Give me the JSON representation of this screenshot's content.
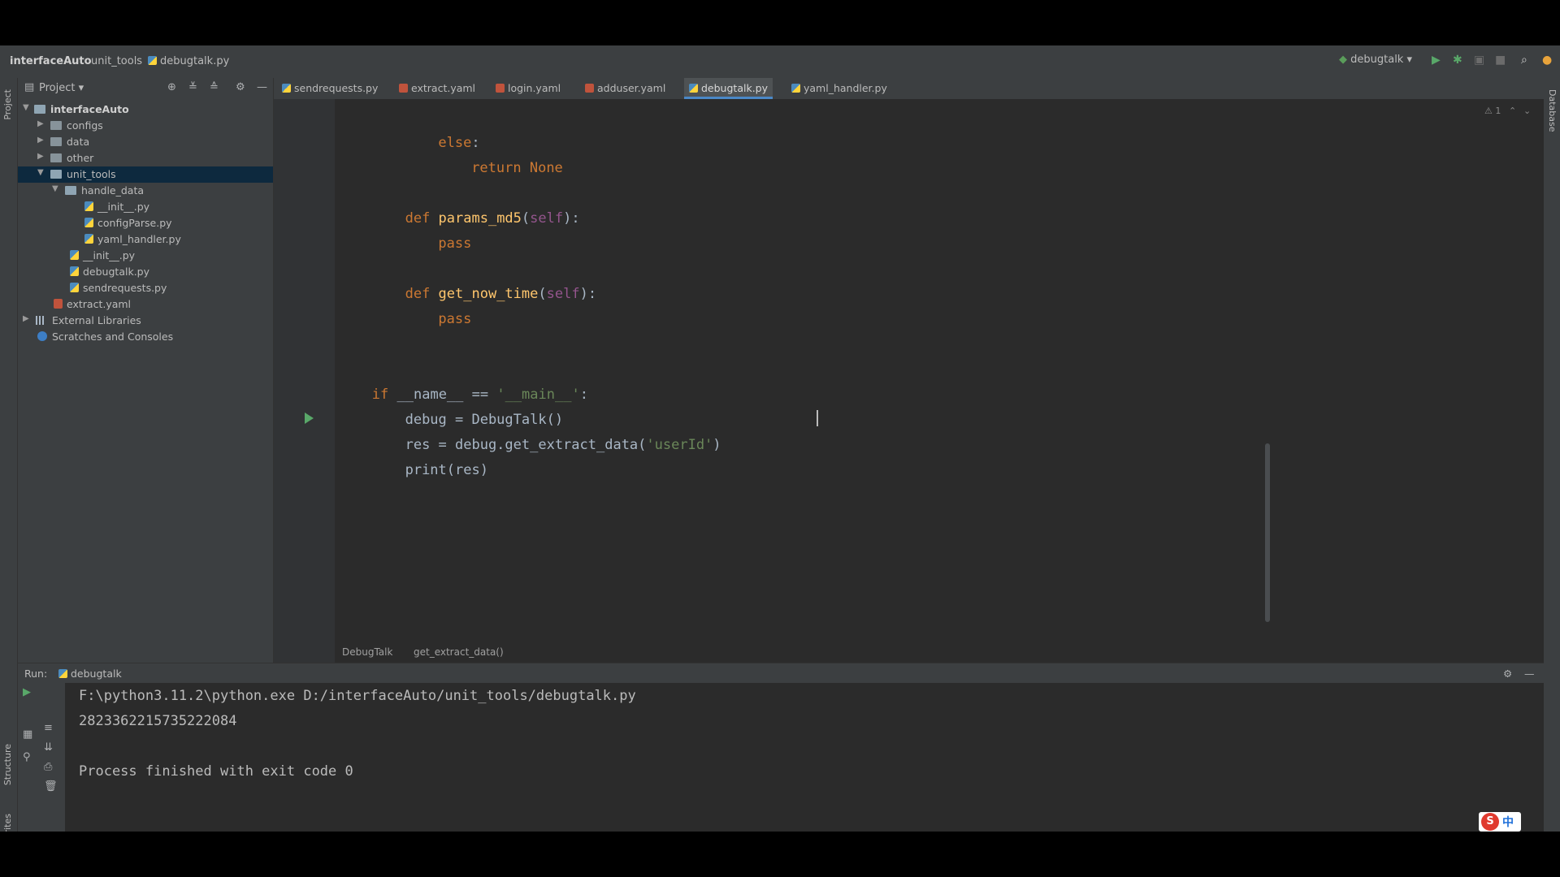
{
  "navbar": {
    "project": "interfaceAuto",
    "folder": "unit_tools",
    "file": "debugtalk.py",
    "run_config": "debugtalk"
  },
  "project_panel": {
    "title": "Project",
    "tree": [
      {
        "name": "interfaceAuto",
        "type": "root",
        "expanded": true
      },
      {
        "name": "configs",
        "type": "folder"
      },
      {
        "name": "data",
        "type": "folder"
      },
      {
        "name": "other",
        "type": "folder"
      },
      {
        "name": "unit_tools",
        "type": "folder",
        "expanded": true,
        "selected": true
      },
      {
        "name": "handle_data",
        "type": "folder",
        "expanded": true
      },
      {
        "name": "__init__.py",
        "type": "py"
      },
      {
        "name": "configParse.py",
        "type": "py"
      },
      {
        "name": "yaml_handler.py",
        "type": "py"
      },
      {
        "name": "__init__.py",
        "type": "py"
      },
      {
        "name": "debugtalk.py",
        "type": "py"
      },
      {
        "name": "sendrequests.py",
        "type": "py"
      },
      {
        "name": "extract.yaml",
        "type": "yaml"
      },
      {
        "name": "External Libraries",
        "type": "lib"
      },
      {
        "name": "Scratches and Consoles",
        "type": "scratch"
      }
    ]
  },
  "tabs": [
    {
      "label": "sendrequests.py",
      "type": "py"
    },
    {
      "label": "extract.yaml",
      "type": "yaml"
    },
    {
      "label": "login.yaml",
      "type": "yaml"
    },
    {
      "label": "adduser.yaml",
      "type": "yaml"
    },
    {
      "label": "debugtalk.py",
      "type": "py",
      "active": true
    },
    {
      "label": "yaml_handler.py",
      "type": "py"
    }
  ],
  "editor": {
    "lines": [
      {
        "indent": 12,
        "tokens": [
          {
            "t": "else",
            "c": "kw"
          },
          {
            "t": ":",
            "c": ""
          }
        ]
      },
      {
        "indent": 16,
        "tokens": [
          {
            "t": "return ",
            "c": "kw"
          },
          {
            "t": "None",
            "c": "kw"
          }
        ]
      },
      {
        "indent": 0,
        "tokens": []
      },
      {
        "indent": 8,
        "tokens": [
          {
            "t": "def ",
            "c": "kw"
          },
          {
            "t": "params_md5",
            "c": "fn"
          },
          {
            "t": "(",
            "c": ""
          },
          {
            "t": "self",
            "c": "self"
          },
          {
            "t": "):",
            "c": ""
          }
        ]
      },
      {
        "indent": 12,
        "tokens": [
          {
            "t": "pass",
            "c": "kw"
          }
        ]
      },
      {
        "indent": 0,
        "tokens": []
      },
      {
        "indent": 8,
        "tokens": [
          {
            "t": "def ",
            "c": "kw"
          },
          {
            "t": "get_now_time",
            "c": "fn"
          },
          {
            "t": "(",
            "c": ""
          },
          {
            "t": "self",
            "c": "self"
          },
          {
            "t": "):",
            "c": ""
          }
        ]
      },
      {
        "indent": 12,
        "tokens": [
          {
            "t": "pass",
            "c": "kw"
          }
        ]
      },
      {
        "indent": 0,
        "tokens": []
      },
      {
        "indent": 0,
        "tokens": []
      },
      {
        "indent": 4,
        "tokens": [
          {
            "t": "if ",
            "c": "kw"
          },
          {
            "t": "__name__ == ",
            "c": ""
          },
          {
            "t": "'__main__'",
            "c": "str"
          },
          {
            "t": ":",
            "c": ""
          }
        ]
      },
      {
        "indent": 8,
        "tokens": [
          {
            "t": "debug = DebugTalk()",
            "c": ""
          }
        ]
      },
      {
        "indent": 8,
        "tokens": [
          {
            "t": "res = debug.get_extract_data(",
            "c": ""
          },
          {
            "t": "'userId'",
            "c": "str"
          },
          {
            "t": ")",
            "c": ""
          }
        ]
      },
      {
        "indent": 8,
        "tokens": [
          {
            "t": "print(res)",
            "c": ""
          }
        ]
      },
      {
        "indent": 0,
        "tokens": []
      }
    ],
    "breadcrumb": [
      "DebugTalk",
      "get_extract_data()"
    ]
  },
  "run_panel": {
    "label": "Run:",
    "config": "debugtalk",
    "output": [
      "F:\\python3.11.2\\python.exe D:/interfaceAuto/unit_tools/debugtalk.py",
      "2823362215735222084",
      "",
      "Process finished with exit code 0"
    ]
  },
  "side_labels": {
    "project": "Project",
    "structure": "Structure",
    "favorites": "Favorites",
    "database": "Database"
  },
  "ime": {
    "icon": "S",
    "mode": "中"
  }
}
